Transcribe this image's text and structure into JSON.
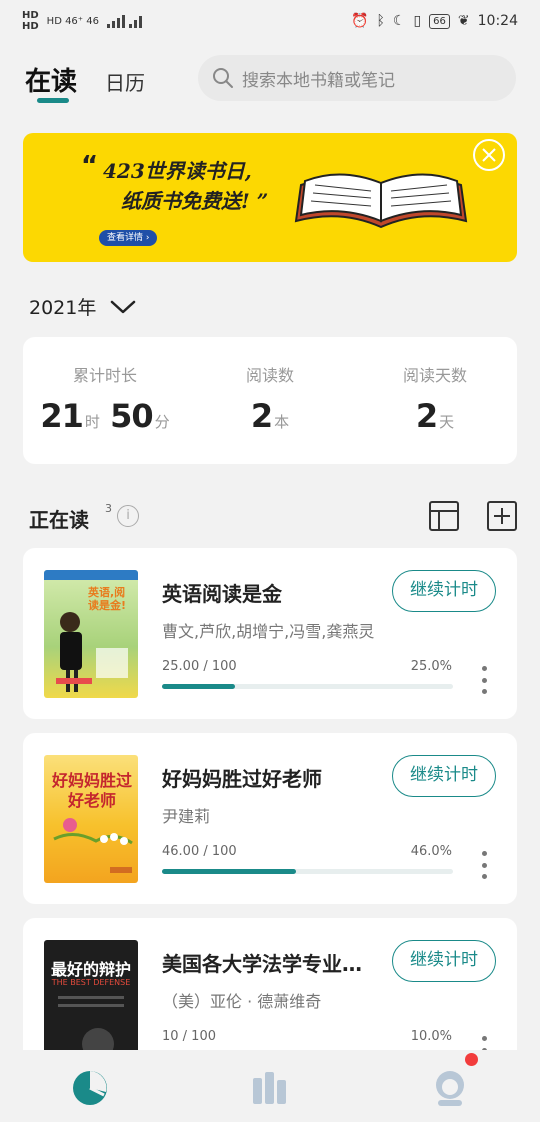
{
  "status_bar": {
    "network_left": "HD 46⁺ 46",
    "battery": "66",
    "time": "10:24"
  },
  "header": {
    "tab_current": "在读",
    "tab_calendar": "日历",
    "search_placeholder": "搜索本地书籍或笔记"
  },
  "banner": {
    "quote_open": "“",
    "line1": "423世界读书日,",
    "line2": "纸质书免费送! ”",
    "detail_button": "查看详情 ›"
  },
  "year_selector": {
    "label": "2021年"
  },
  "stats": [
    {
      "label": "累计时长",
      "value1": "21",
      "unit1": "时",
      "value2": "50",
      "unit2": "分"
    },
    {
      "label": "阅读数",
      "value1": "2",
      "unit1": "本"
    },
    {
      "label": "阅读天数",
      "value1": "2",
      "unit1": "天"
    }
  ],
  "section": {
    "title": "正在读",
    "count": "3",
    "info": "i"
  },
  "books": [
    {
      "title": "英语阅读是金",
      "author": "曹文,芦欣,胡增宁,冯雪,龚燕灵",
      "button": "继续计时",
      "progress_text": "25.00 / 100",
      "progress_pct": "25.0%",
      "progress": 0.25,
      "cover_text": "英语,阅读是金!",
      "cover_color": "#bfe09a"
    },
    {
      "title": "好妈妈胜过好老师",
      "author": "尹建莉",
      "button": "继续计时",
      "progress_text": "46.00 / 100",
      "progress_pct": "46.0%",
      "progress": 0.46,
      "cover_text": "好妈妈胜过好老师",
      "cover_color": "#f7c12c"
    },
    {
      "title": "美国各大学法学专业…",
      "author": "（美）亚伦 · 德萧维奇",
      "button": "继续计时",
      "progress_text": "10 / 100",
      "progress_pct": "10.0%",
      "progress": 0.1,
      "cover_text": "最好的辩护",
      "cover_subtext": "THE BEST DEFENSE",
      "cover_color": "#1e1e1e"
    }
  ],
  "nav": {
    "items": [
      "reading-stats-icon",
      "bookshelf-icon",
      "profile-icon"
    ],
    "accent": "#1a8a89"
  }
}
